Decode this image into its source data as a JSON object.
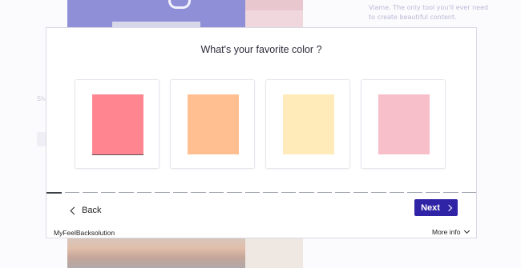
{
  "background": {
    "side_text": "Viame. The only tool you'll ever need to create beautiful content.",
    "left_text": "Sha No eye"
  },
  "modal": {
    "question": "What's your favorite color ?",
    "options": [
      {
        "name": "color-option-pink-red",
        "color": "#ff8591"
      },
      {
        "name": "color-option-peach",
        "color": "#ffbf91"
      },
      {
        "name": "color-option-pale-yellow",
        "color": "#ffebb9"
      },
      {
        "name": "color-option-light-pink",
        "color": "#f7bfc9"
      }
    ],
    "progress": {
      "total_steps": 24,
      "current_step": 1
    },
    "back_label": "Back",
    "next_label": "Next",
    "footer_brand": "MyFeelBacksolution",
    "footer_more": "More info"
  },
  "colors": {
    "accent": "#2f23a6",
    "modal_border": "#d9d9e6"
  },
  "icons": {
    "back": "chevron-left-icon",
    "next": "chevron-right-icon",
    "more": "chevron-down-icon"
  }
}
